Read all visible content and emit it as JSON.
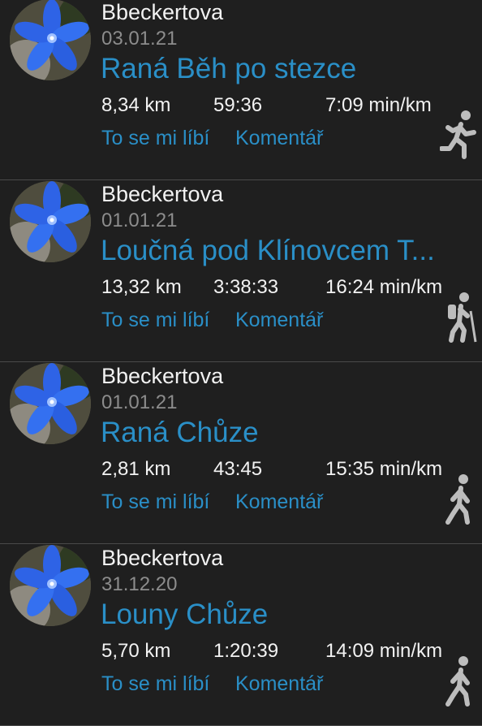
{
  "colors": {
    "background": "#1f1f1f",
    "accent": "#2a8fc7",
    "secondary_text": "#8c8c8c",
    "divider": "#4a4a4a"
  },
  "feed": {
    "items": [
      {
        "user": "Bbeckertova",
        "date": "03.01.21",
        "title": "Raná Běh po stezce",
        "distance": "8,34 km",
        "duration": "59:36",
        "pace": "7:09 min/km",
        "like_label": "To se mi líbí",
        "comment_label": "Komentář",
        "activity_icon": "running-icon"
      },
      {
        "user": "Bbeckertova",
        "date": "01.01.21",
        "title": "Loučná pod Klínovcem T...",
        "distance": "13,32 km",
        "duration": "3:38:33",
        "pace": "16:24 min/km",
        "like_label": "To se mi líbí",
        "comment_label": "Komentář",
        "activity_icon": "hiking-icon"
      },
      {
        "user": "Bbeckertova",
        "date": "01.01.21",
        "title": "Raná Chůze",
        "distance": "2,81 km",
        "duration": "43:45",
        "pace": "15:35 min/km",
        "like_label": "To se mi líbí",
        "comment_label": "Komentář",
        "activity_icon": "walking-icon"
      },
      {
        "user": "Bbeckertova",
        "date": "31.12.20",
        "title": "Louny Chůze",
        "distance": "5,70 km",
        "duration": "1:20:39",
        "pace": "14:09 min/km",
        "like_label": "To se mi líbí",
        "comment_label": "Komentář",
        "activity_icon": "walking-icon"
      }
    ]
  }
}
